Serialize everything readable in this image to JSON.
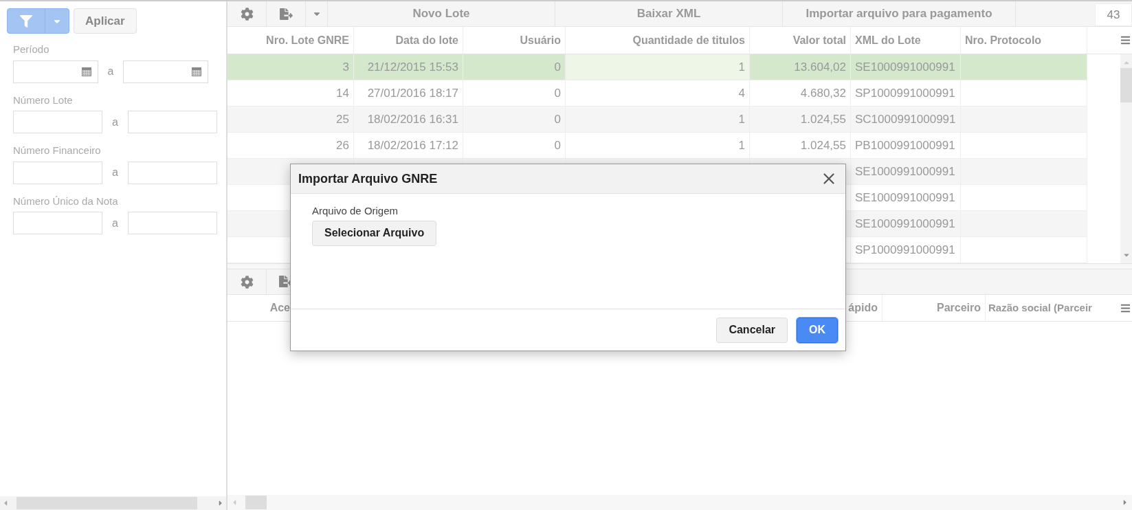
{
  "filter_panel": {
    "apply_button": "Aplicar",
    "fields": [
      {
        "label": "Período",
        "kind": "date",
        "separator": "a"
      },
      {
        "label": "Número Lote",
        "kind": "text",
        "separator": "a"
      },
      {
        "label": "Número Financeiro",
        "kind": "text",
        "separator": "a"
      },
      {
        "label": "Número Único da Nota",
        "kind": "text",
        "separator": "a"
      }
    ]
  },
  "toolbar": {
    "buttons": [
      "Novo Lote",
      "Baixar XML",
      "Importar arquivo para pagamento"
    ],
    "count": "43"
  },
  "table": {
    "columns": [
      "Nro. Lote GNRE",
      "Data do lote",
      "Usuário",
      "Quantidade de titulos",
      "Valor total",
      "XML do Lote",
      "Nro. Protocolo"
    ],
    "rows": [
      {
        "selected": true,
        "focused": true,
        "lote": "3",
        "data": "21/12/2015 15:53",
        "usuario": "0",
        "quantidade": "1",
        "valor": "13.604,02",
        "xml": "SE1000991000991"
      },
      {
        "selected": false,
        "lote": "14",
        "data": "27/01/2016 18:17",
        "usuario": "0",
        "quantidade": "4",
        "valor": "4.680,32",
        "xml": "SP1000991000991"
      },
      {
        "selected": false,
        "lote": "25",
        "data": "18/02/2016 16:31",
        "usuario": "0",
        "quantidade": "1",
        "valor": "1.024,55",
        "xml": "SC1000991000991"
      },
      {
        "selected": false,
        "lote": "26",
        "data": "18/02/2016 17:12",
        "usuario": "0",
        "quantidade": "1",
        "valor": "1.024,55",
        "xml": "PB1000991000991"
      },
      {
        "selected": false,
        "xml": "SE1000991000991"
      },
      {
        "selected": false,
        "xml": "SE1000991000991"
      },
      {
        "selected": false,
        "xml": "SE1000991000991"
      },
      {
        "selected": false,
        "xml": "SP1000991000991"
      }
    ]
  },
  "detail_table": {
    "columns": [
      "Ace",
      "ápido",
      "Parceiro",
      "Razão social (Parceir"
    ]
  },
  "dialog": {
    "title": "Importar Arquivo GNRE",
    "field_label": "Arquivo de Origem",
    "select_button": "Selecionar Arquivo",
    "buttons": [
      {
        "label": "Cancelar",
        "primary": false
      },
      {
        "label": "OK",
        "primary": true
      }
    ]
  }
}
